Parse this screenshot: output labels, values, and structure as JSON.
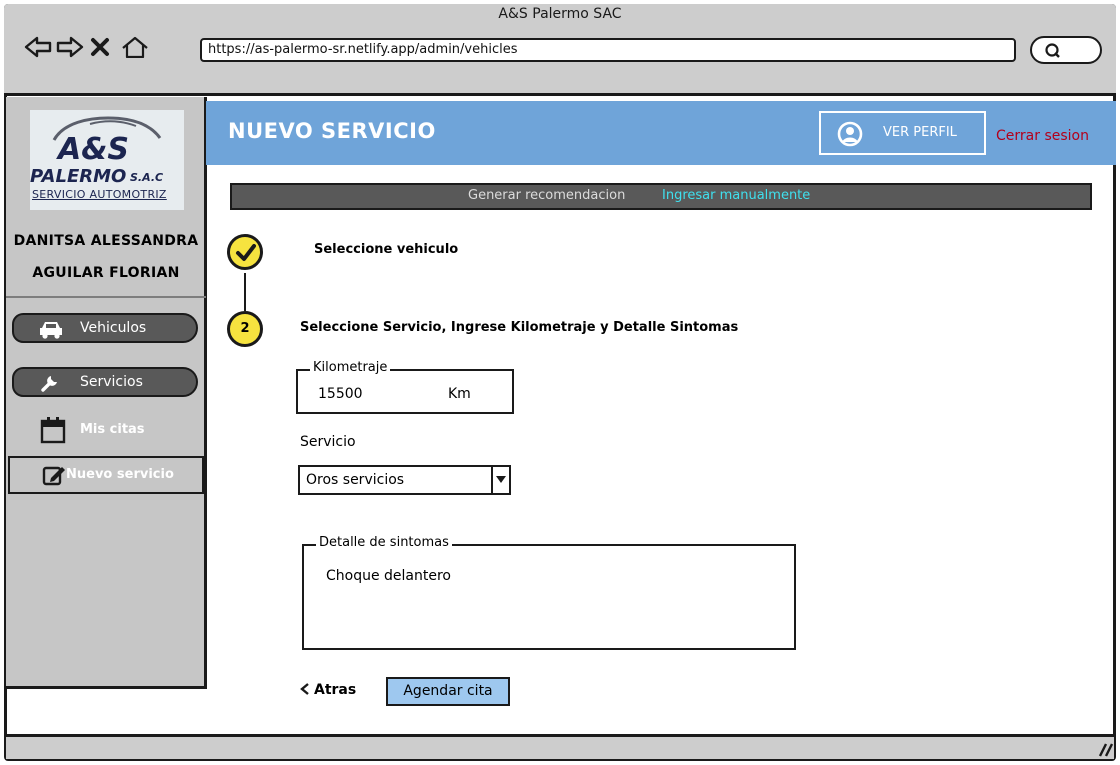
{
  "browser": {
    "window_title": "A&S Palermo SAC",
    "url": "https://as-palermo-sr.netlify.app/admin/vehicles"
  },
  "sidebar": {
    "logo": {
      "letters": "A&S",
      "name": "PALERMO",
      "suffix": "S.A.C",
      "tagline": "SERVICIO AUTOMOTRIZ"
    },
    "user_first": "DANITSA ALESSANDRA",
    "user_last": "AGUILAR FLORIAN",
    "items": [
      {
        "label": "Vehiculos",
        "icon": "car-icon"
      },
      {
        "label": "Servicios",
        "icon": "wrench-icon"
      },
      {
        "label": "Mis citas",
        "icon": "calendar-icon"
      },
      {
        "label": "Nuevo servicio",
        "icon": "edit-icon"
      }
    ]
  },
  "header": {
    "title": "NUEVO SERVICIO",
    "profile_label": "VER PERFIL",
    "logout_label": "Cerrar sesion"
  },
  "tabs": {
    "generate": "Generar recomendacion",
    "manual": "Ingresar manualmente"
  },
  "steps": [
    {
      "marker": "check",
      "label": "Seleccione vehiculo"
    },
    {
      "marker": "2",
      "label": "Seleccione Servicio, Ingrese Kilometraje y Detalle Sintomas"
    }
  ],
  "form": {
    "km_legend": "Kilometraje",
    "km_value": "15500",
    "km_unit": "Km",
    "service_label": "Servicio",
    "service_selected": "Oros servicios",
    "symptoms_legend": "Detalle de sintomas",
    "symptoms_value": "Choque delantero",
    "back_label": "Atras",
    "submit_label": "Agendar cita"
  },
  "colors": {
    "header": "#6fa4d9",
    "sidebar": "#c6c6c6",
    "step_marker": "#f6e33f",
    "logout": "#b3001b",
    "tab_active": "#3fe0ee",
    "primary_button": "#9ec8ef"
  }
}
